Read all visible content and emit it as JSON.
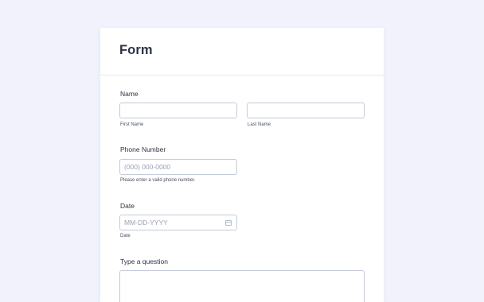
{
  "form": {
    "title": "Form",
    "name": {
      "label": "Name",
      "first_sublabel": "First Name",
      "last_sublabel": "Last Name"
    },
    "phone": {
      "label": "Phone Number",
      "placeholder": "(000) 000-0000",
      "sublabel": "Please enter a valid phone number."
    },
    "date": {
      "label": "Date",
      "placeholder": "MM-DD-YYYY",
      "sublabel": "Date",
      "icon": "calendar-icon"
    },
    "question": {
      "label": "Type a question"
    }
  }
}
